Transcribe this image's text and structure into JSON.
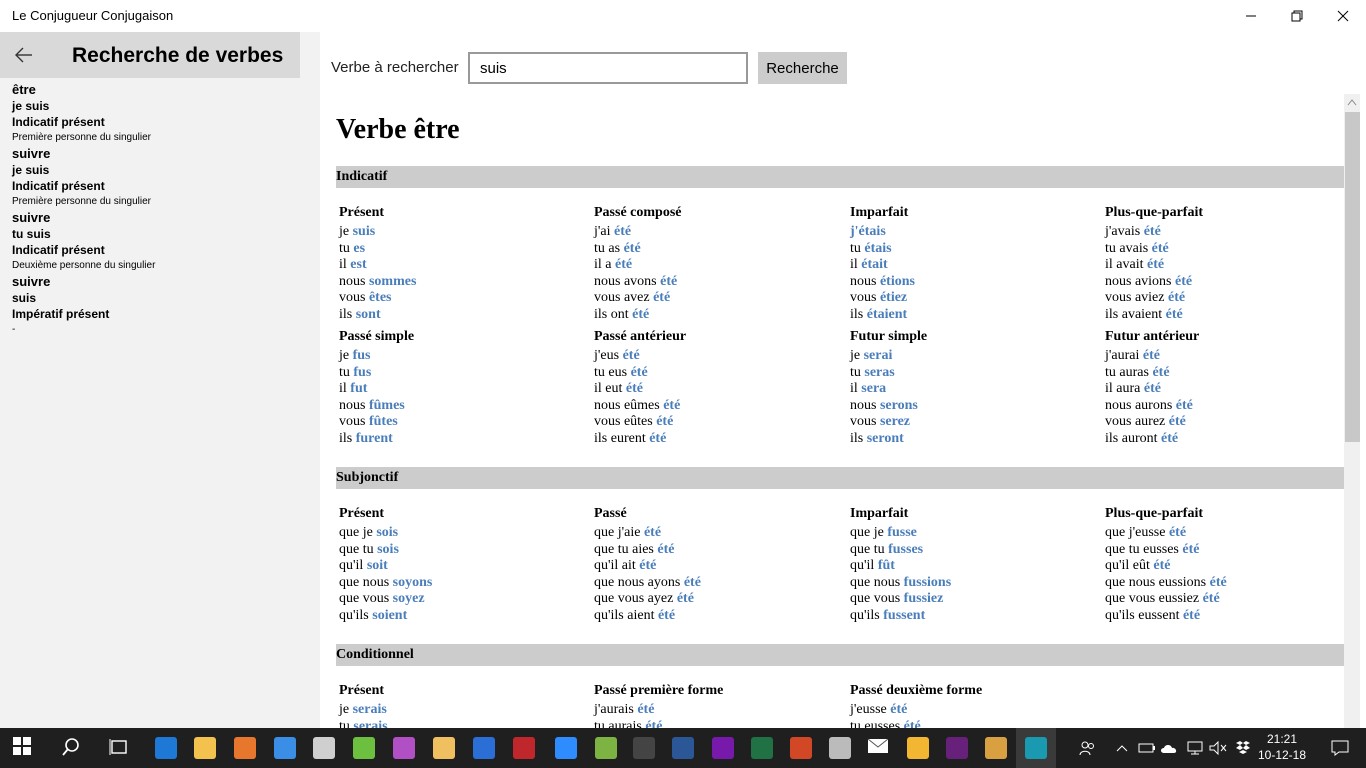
{
  "app": {
    "title": "Le Conjugueur Conjugaison"
  },
  "sidebar": {
    "title": "Recherche de verbes",
    "results": [
      {
        "verb": "être",
        "form": "je suis",
        "tense": "Indicatif présent",
        "person": "Première personne du singulier"
      },
      {
        "verb": "suivre",
        "form": "je suis",
        "tense": "Indicatif présent",
        "person": "Première personne du singulier"
      },
      {
        "verb": "suivre",
        "form": "tu suis",
        "tense": "Indicatif présent",
        "person": "Deuxième personne du singulier"
      },
      {
        "verb": "suivre",
        "form": "suis",
        "tense": "Impératif présent",
        "person": "-"
      }
    ]
  },
  "search": {
    "label": "Verbe à rechercher",
    "value": "suis",
    "button": "Recherche"
  },
  "verb_title": "Verbe être",
  "colors": {
    "accent_link": "#4a7ebb",
    "mood_header_bg": "#cccccc",
    "sidebar_bg": "#f2f2f2",
    "sidebar_header_bg": "#d9d9d9",
    "taskbar_bg": "#1f1f1f"
  },
  "moods": [
    {
      "name": "Indicatif",
      "tenses": [
        {
          "name": "Présent",
          "lines": [
            [
              "je ",
              "suis"
            ],
            [
              "tu ",
              "es"
            ],
            [
              "il ",
              "est"
            ],
            [
              "nous ",
              "sommes"
            ],
            [
              "vous ",
              "êtes"
            ],
            [
              "ils ",
              "sont"
            ]
          ]
        },
        {
          "name": "Passé composé",
          "lines": [
            [
              "j'ai ",
              "été"
            ],
            [
              "tu as ",
              "été"
            ],
            [
              "il a ",
              "été"
            ],
            [
              "nous avons ",
              "été"
            ],
            [
              "vous avez ",
              "été"
            ],
            [
              "ils ont ",
              "été"
            ]
          ]
        },
        {
          "name": "Imparfait",
          "lines": [
            [
              "",
              "j'étais"
            ],
            [
              "tu ",
              "étais"
            ],
            [
              "il ",
              "était"
            ],
            [
              "nous ",
              "étions"
            ],
            [
              "vous ",
              "étiez"
            ],
            [
              "ils ",
              "étaient"
            ]
          ]
        },
        {
          "name": "Plus-que-parfait",
          "lines": [
            [
              "j'avais ",
              "été"
            ],
            [
              "tu avais ",
              "été"
            ],
            [
              "il avait ",
              "été"
            ],
            [
              "nous avions ",
              "été"
            ],
            [
              "vous aviez ",
              "été"
            ],
            [
              "ils avaient ",
              "été"
            ]
          ]
        },
        {
          "name": "Passé simple",
          "lines": [
            [
              "je ",
              "fus"
            ],
            [
              "tu ",
              "fus"
            ],
            [
              "il ",
              "fut"
            ],
            [
              "nous ",
              "fûmes"
            ],
            [
              "vous ",
              "fûtes"
            ],
            [
              "ils ",
              "furent"
            ]
          ]
        },
        {
          "name": "Passé antérieur",
          "lines": [
            [
              "j'eus ",
              "été"
            ],
            [
              "tu eus ",
              "été"
            ],
            [
              "il eut ",
              "été"
            ],
            [
              "nous eûmes ",
              "été"
            ],
            [
              "vous eûtes ",
              "été"
            ],
            [
              "ils eurent ",
              "été"
            ]
          ]
        },
        {
          "name": "Futur simple",
          "lines": [
            [
              "je ",
              "serai"
            ],
            [
              "tu ",
              "seras"
            ],
            [
              "il ",
              "sera"
            ],
            [
              "nous ",
              "serons"
            ],
            [
              "vous ",
              "serez"
            ],
            [
              "ils ",
              "seront"
            ]
          ]
        },
        {
          "name": "Futur antérieur",
          "lines": [
            [
              "j'aurai ",
              "été"
            ],
            [
              "tu auras ",
              "été"
            ],
            [
              "il aura ",
              "été"
            ],
            [
              "nous aurons ",
              "été"
            ],
            [
              "vous aurez ",
              "été"
            ],
            [
              "ils auront ",
              "été"
            ]
          ]
        }
      ]
    },
    {
      "name": "Subjonctif",
      "tenses": [
        {
          "name": "Présent",
          "lines": [
            [
              "que je ",
              "sois"
            ],
            [
              "que tu ",
              "sois"
            ],
            [
              "qu'il ",
              "soit"
            ],
            [
              "que nous ",
              "soyons"
            ],
            [
              "que vous ",
              "soyez"
            ],
            [
              "qu'ils ",
              "soient"
            ]
          ]
        },
        {
          "name": "Passé",
          "lines": [
            [
              "que j'aie ",
              "été"
            ],
            [
              "que tu aies ",
              "été"
            ],
            [
              "qu'il ait ",
              "été"
            ],
            [
              "que nous ayons ",
              "été"
            ],
            [
              "que vous ayez ",
              "été"
            ],
            [
              "qu'ils aient ",
              "été"
            ]
          ]
        },
        {
          "name": "Imparfait",
          "lines": [
            [
              "que je ",
              "fusse"
            ],
            [
              "que tu ",
              "fusses"
            ],
            [
              "qu'il ",
              "fût"
            ],
            [
              "que nous ",
              "fussions"
            ],
            [
              "que vous ",
              "fussiez"
            ],
            [
              "qu'ils ",
              "fussent"
            ]
          ]
        },
        {
          "name": "Plus-que-parfait",
          "lines": [
            [
              "que j'eusse ",
              "été"
            ],
            [
              "que tu eusses ",
              "été"
            ],
            [
              "qu'il eût ",
              "été"
            ],
            [
              "que nous eussions ",
              "été"
            ],
            [
              "que vous eussiez ",
              "été"
            ],
            [
              "qu'ils eussent ",
              "été"
            ]
          ]
        }
      ]
    },
    {
      "name": "Conditionnel",
      "tenses": [
        {
          "name": "Présent",
          "lines": [
            [
              "je ",
              "serais"
            ],
            [
              "tu ",
              "serais"
            ]
          ]
        },
        {
          "name": "Passé première forme",
          "lines": [
            [
              "j'aurais ",
              "été"
            ],
            [
              "tu aurais ",
              "été"
            ]
          ]
        },
        {
          "name": "Passé deuxième forme",
          "lines": [
            [
              "j'eusse ",
              "été"
            ],
            [
              "tu eusses ",
              "été"
            ]
          ]
        }
      ]
    }
  ],
  "taskbar": {
    "apps": [
      "windows-start-icon",
      "search-icon",
      "task-view-icon",
      "edge-icon",
      "file-explorer-icon",
      "firefox-icon",
      "store-icon",
      "app-icon",
      "notepad-icon",
      "onenote-purple-icon",
      "explorer-icon",
      "azure-icon",
      "filezilla-icon",
      "dropbox-icon",
      "android-icon",
      "terminal-icon",
      "word-icon",
      "onenote-icon",
      "excel-icon",
      "powerpoint-icon",
      "inkscape-icon",
      "mail-icon",
      "chrome-icon",
      "visual-studio-icon",
      "paint-icon",
      "conjugueur-app-icon"
    ],
    "time": "21:21",
    "date": "10-12-18"
  }
}
